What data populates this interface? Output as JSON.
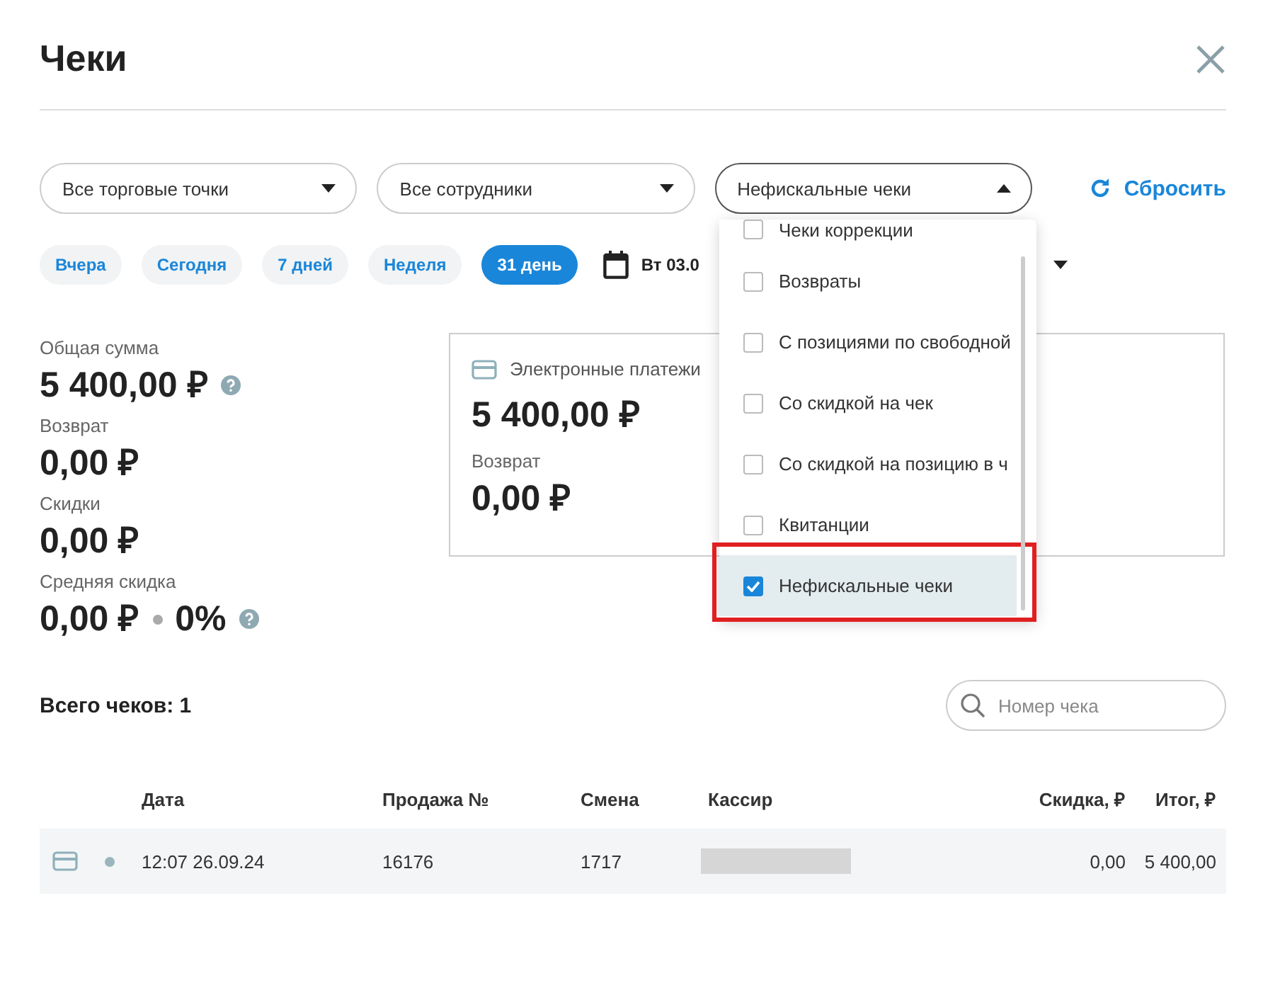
{
  "title": "Чеки",
  "filters": [
    {
      "label": "Все торговые точки",
      "expanded": false
    },
    {
      "label": "Все сотрудники",
      "expanded": false
    },
    {
      "label": "Нефискальные чеки",
      "expanded": true
    }
  ],
  "reset": "Сбросить",
  "periods": [
    {
      "label": "Вчера",
      "selected": false
    },
    {
      "label": "Сегодня",
      "selected": false
    },
    {
      "label": "7 дней",
      "selected": false
    },
    {
      "label": "Неделя",
      "selected": false
    },
    {
      "label": "31 день",
      "selected": true
    }
  ],
  "date_range": "Вт 03.0",
  "stats": [
    {
      "label": "Общая сумма",
      "value": "5 400,00 ₽",
      "help": true
    },
    {
      "label": "Возврат",
      "value": "0,00 ₽",
      "help": false
    },
    {
      "label": "Скидки",
      "value": "0,00 ₽",
      "help": false
    },
    {
      "label": "Средняя скидка",
      "value": "0,00 ₽",
      "extra": "0%",
      "help": true
    }
  ],
  "payment_card": {
    "title": "Электронные платежи",
    "amount": "5 400,00 ₽",
    "refund_label": "Возврат",
    "refund": "0,00 ₽"
  },
  "dropdown": {
    "items": [
      {
        "label": "Чеки коррекции",
        "checked": false,
        "highlighted": false
      },
      {
        "label": "Возвраты",
        "checked": false,
        "highlighted": false
      },
      {
        "label": "С позициями по свободной",
        "checked": false,
        "highlighted": false
      },
      {
        "label": "Со скидкой на чек",
        "checked": false,
        "highlighted": false
      },
      {
        "label": "Со скидкой на позицию в ч",
        "checked": false,
        "highlighted": false
      },
      {
        "label": "Квитанции",
        "checked": false,
        "highlighted": false
      },
      {
        "label": "Нефискальные чеки",
        "checked": true,
        "highlighted": true
      }
    ]
  },
  "total": "Всего чеков: 1",
  "search": {
    "placeholder": "Номер чека"
  },
  "table": {
    "columns": [
      "Дата",
      "Продажа №",
      "Смена",
      "Кассир",
      "Скидка, ₽",
      "Итог, ₽"
    ],
    "rows": [
      {
        "date": "12:07 26.09.24",
        "sale": "16176",
        "shift": "1717",
        "discount": "0,00",
        "total": "5 400,00"
      }
    ]
  }
}
